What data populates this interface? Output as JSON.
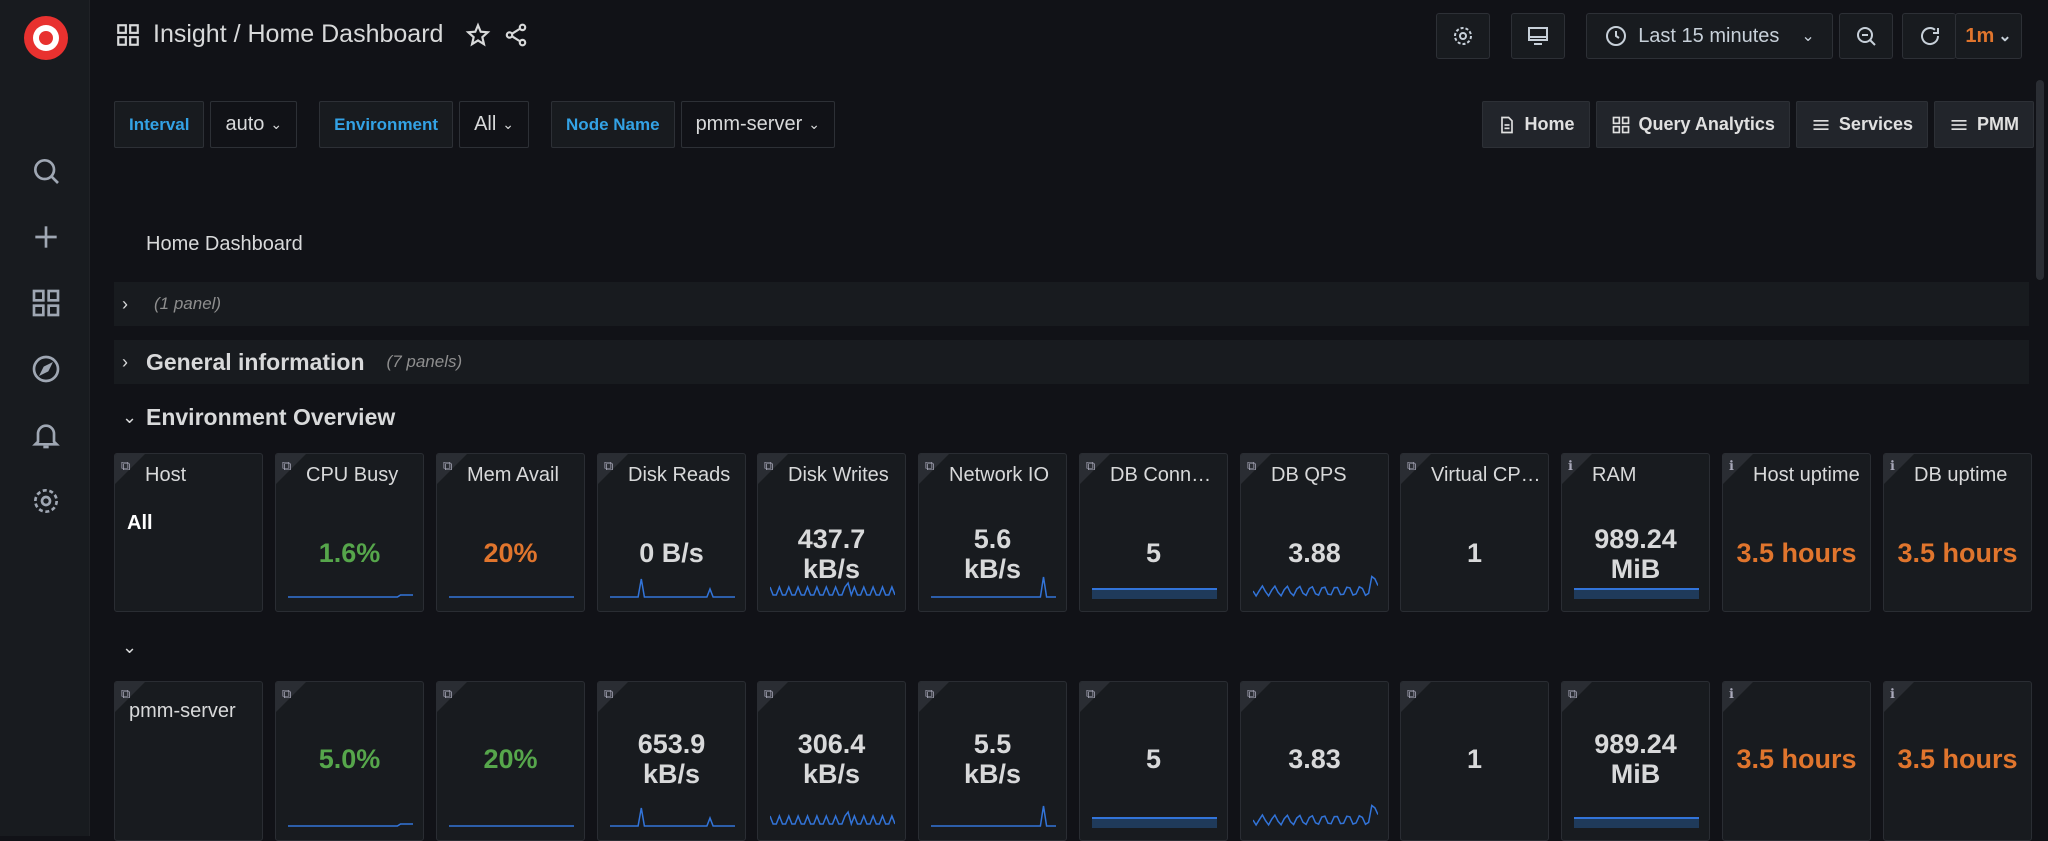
{
  "header": {
    "breadcrumb": "Insight / Home Dashboard",
    "time_range": "Last 15 minutes",
    "refresh_interval": "1m"
  },
  "variables": [
    {
      "label": "Interval",
      "value": "auto"
    },
    {
      "label": "Environment",
      "value": "All"
    },
    {
      "label": "Node Name",
      "value": "pmm-server"
    }
  ],
  "links": [
    "Home",
    "Query Analytics",
    "Services",
    "PMM"
  ],
  "dashboard_title": "Home Dashboard",
  "rows": {
    "row1_count": "(1 panel)",
    "general_title": "General information",
    "general_count": "(7 panels)",
    "env_title": "Environment Overview"
  },
  "env_panels": [
    {
      "title": "Host",
      "value": "All",
      "color": "white"
    },
    {
      "title": "CPU Busy",
      "value": "1.6%",
      "color": "green"
    },
    {
      "title": "Mem Avail",
      "value": "20%",
      "color": "orange"
    },
    {
      "title": "Disk Reads",
      "value": "0 B/s",
      "color": "white"
    },
    {
      "title": "Disk Writes",
      "value": "437.7 kB/s",
      "color": "white"
    },
    {
      "title": "Network IO",
      "value": "5.6 kB/s",
      "color": "white"
    },
    {
      "title": "DB Connections",
      "value": "5",
      "color": "white"
    },
    {
      "title": "DB QPS",
      "value": "3.88",
      "color": "white"
    },
    {
      "title": "Virtual CPUs",
      "value": "1",
      "color": "white"
    },
    {
      "title": "RAM",
      "value": "989.24 MiB",
      "color": "white"
    },
    {
      "title": "Host uptime",
      "value": "3.5 hours",
      "color": "orange"
    },
    {
      "title": "DB uptime",
      "value": "3.5 hours",
      "color": "orange"
    }
  ],
  "node_panels": [
    {
      "title": "pmm-server",
      "value": "",
      "color": "white"
    },
    {
      "title": "",
      "value": "5.0%",
      "color": "green"
    },
    {
      "title": "",
      "value": "20%",
      "color": "green"
    },
    {
      "title": "",
      "value": "653.9 kB/s",
      "color": "white"
    },
    {
      "title": "",
      "value": "306.4 kB/s",
      "color": "white"
    },
    {
      "title": "",
      "value": "5.5 kB/s",
      "color": "white"
    },
    {
      "title": "",
      "value": "5",
      "color": "white"
    },
    {
      "title": "",
      "value": "3.83",
      "color": "white"
    },
    {
      "title": "",
      "value": "1",
      "color": "white"
    },
    {
      "title": "",
      "value": "989.24 MiB",
      "color": "white"
    },
    {
      "title": "",
      "value": "3.5 hours",
      "color": "orange"
    },
    {
      "title": "",
      "value": "3.5 hours",
      "color": "orange"
    }
  ],
  "colors": {
    "accent_blue": "#33a2e5",
    "green": "#56a64b",
    "orange": "#e0752d",
    "spark": "#3274d9"
  }
}
